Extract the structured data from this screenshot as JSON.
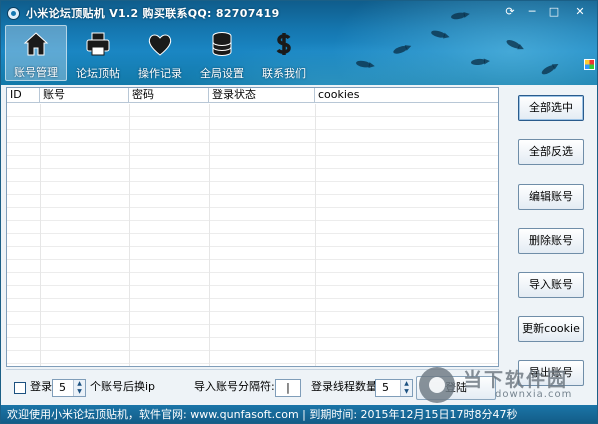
{
  "window": {
    "title": "小米论坛顶贴机 V1.2 购买联系QQ: 82707419",
    "controls": [
      "⟳",
      "─",
      "□",
      "✕"
    ]
  },
  "nav": {
    "items": [
      {
        "label": "账号管理",
        "icon": "home-icon",
        "active": true
      },
      {
        "label": "论坛顶帖",
        "icon": "printer-icon",
        "active": false
      },
      {
        "label": "操作记录",
        "icon": "heart-icon",
        "active": false
      },
      {
        "label": "全局设置",
        "icon": "database-icon",
        "active": false
      },
      {
        "label": "联系我们",
        "icon": "dollar-icon",
        "active": false
      }
    ]
  },
  "table": {
    "columns": [
      "ID",
      "账号",
      "密码",
      "登录状态",
      "cookies"
    ],
    "rows": []
  },
  "options": {
    "login_label": "登录",
    "login_count": "5",
    "switch_ip_label": "个账号后换ip",
    "separator_label": "导入账号分隔符:",
    "separator_value": "|",
    "threads_label": "登录线程数量",
    "threads_value": "5",
    "login_button": "登陆"
  },
  "side_buttons": {
    "select_all": "全部选中",
    "invert_selection": "全部反选",
    "edit_account": "编辑账号",
    "delete_account": "删除账号",
    "import_account": "导入账号",
    "update_cookie": "更新cookie",
    "export_account": "导出账号"
  },
  "status_bar": {
    "text": "欢迎使用小米论坛顶贴机，软件官网: www.qunfasoft.com  | 到期时间: 2015年12月15日17时8分47秒"
  },
  "watermark": {
    "cn": "当下软件园",
    "en": "downxia.com"
  },
  "colors": {
    "header": "#1577b0",
    "status_bar": "#125a84",
    "background": "#eef3f7"
  }
}
